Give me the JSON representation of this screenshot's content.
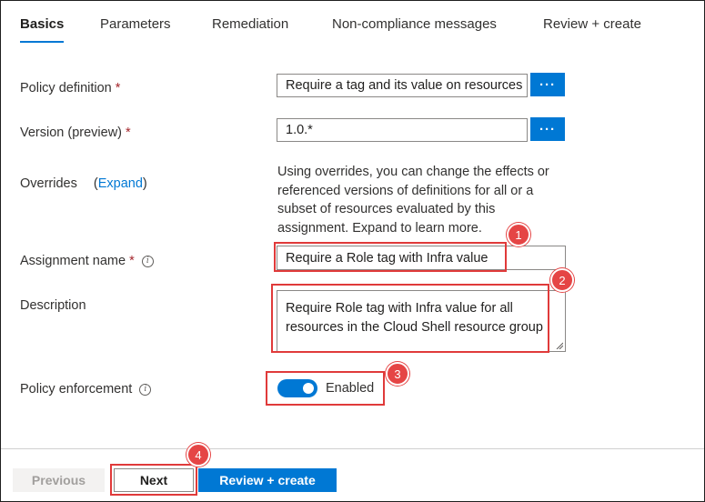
{
  "tabs": [
    {
      "label": "Basics",
      "active": true
    },
    {
      "label": "Parameters"
    },
    {
      "label": "Remediation"
    },
    {
      "label": "Non-compliance messages"
    },
    {
      "label": "Review + create"
    }
  ],
  "form": {
    "policy_definition": {
      "label": "Policy definition",
      "required": "*",
      "value": "Require a tag and its value on resources",
      "browse": "···"
    },
    "version": {
      "label": "Version (preview)",
      "required": "*",
      "value": "1.0.*",
      "browse": "···"
    },
    "overrides": {
      "label": "Overrides",
      "expand_link": "Expand",
      "open_paren": "(",
      "close_paren": ")",
      "help_text": "Using overrides, you can change the effects or referenced versions of definitions for all or a subset of resources evaluated by this assignment. Expand to learn more."
    },
    "assignment_name": {
      "label": "Assignment name",
      "required": "*",
      "value": "Require a Role tag with Infra value",
      "info": "i"
    },
    "description": {
      "label": "Description",
      "value": "Require Role tag with Infra value for all resources in the Cloud Shell resource group"
    },
    "policy_enforcement": {
      "label": "Policy enforcement",
      "info": "i",
      "state": "Enabled"
    }
  },
  "footer": {
    "previous": "Previous",
    "next": "Next",
    "review_create": "Review + create"
  },
  "callouts": [
    "1",
    "2",
    "3",
    "4"
  ],
  "colors": {
    "accent": "#0078d4",
    "callout": "#e03a3a"
  }
}
